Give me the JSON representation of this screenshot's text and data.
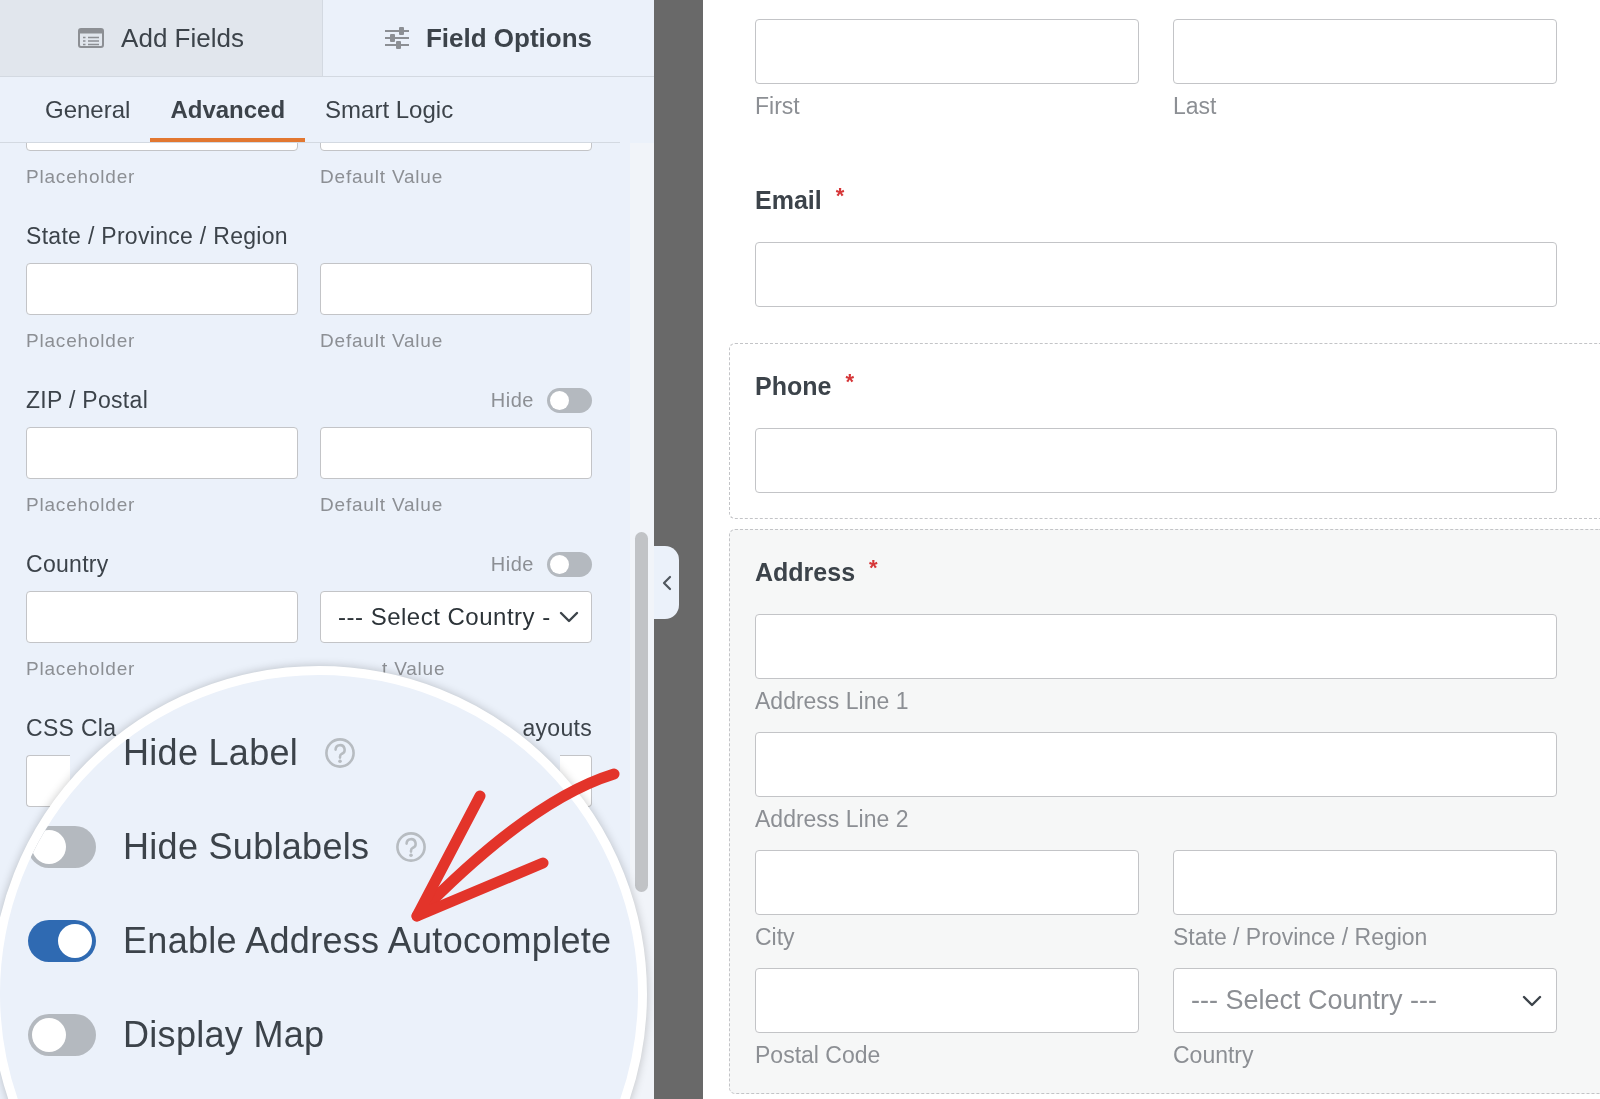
{
  "panel_tabs": [
    {
      "label": "Add Fields",
      "selected": false
    },
    {
      "label": "Field Options",
      "selected": true
    }
  ],
  "option_tabs": [
    {
      "label": "General",
      "selected": false
    },
    {
      "label": "Advanced",
      "selected": true
    },
    {
      "label": "Smart Logic",
      "selected": false
    }
  ],
  "option_sections": [
    {
      "fields": [
        {
          "kind": "input",
          "sublabel": "Placeholder"
        },
        {
          "kind": "input",
          "sublabel": "Default Value"
        }
      ]
    },
    {
      "label": "State / Province / Region",
      "fields": [
        {
          "kind": "input",
          "sublabel": "Placeholder"
        },
        {
          "kind": "input",
          "sublabel": "Default Value"
        }
      ]
    },
    {
      "label": "ZIP / Postal",
      "hide_toggle": {
        "label": "Hide",
        "on": false
      },
      "fields": [
        {
          "kind": "input",
          "sublabel": "Placeholder"
        },
        {
          "kind": "input",
          "sublabel": "Default Value"
        }
      ]
    },
    {
      "label": "Country",
      "hide_toggle": {
        "label": "Hide",
        "on": false
      },
      "fields": [
        {
          "kind": "input",
          "sublabel": "Placeholder"
        },
        {
          "kind": "select",
          "value": "--- Select Country -",
          "sublabel": "t Value"
        }
      ]
    },
    {
      "label": "CSS Cla",
      "aside": "ayouts",
      "fields": [
        {
          "kind": "input"
        },
        {
          "kind": "input"
        }
      ]
    }
  ],
  "magnifier": {
    "options": [
      {
        "label": "Hide Label",
        "help": true
      },
      {
        "label": "Hide Sublabels",
        "on": false,
        "help": true
      },
      {
        "label": "Enable Address Autocomplete",
        "on": true,
        "help": false
      },
      {
        "label": "Display Map",
        "on": false,
        "help": false
      }
    ]
  },
  "form_preview": {
    "fields": [
      {
        "selected": false,
        "hovered": false,
        "rows": [
          [
            {
              "kind": "input",
              "sublabel": "First"
            },
            {
              "kind": "input",
              "sublabel": "Last"
            }
          ]
        ]
      },
      {
        "label": "Email",
        "required_mark": "*",
        "selected": false,
        "hovered": false,
        "rows": [
          [
            {
              "kind": "input"
            }
          ]
        ]
      },
      {
        "label": "Phone",
        "required_mark": "*",
        "selected": false,
        "hovered": true,
        "rows": [
          [
            {
              "kind": "input"
            }
          ]
        ]
      },
      {
        "label": "Address",
        "required_mark": "*",
        "selected": true,
        "hovered": false,
        "rows": [
          [
            {
              "kind": "input",
              "sublabel": "Address Line 1"
            }
          ],
          [
            {
              "kind": "input",
              "sublabel": "Address Line 2"
            }
          ],
          [
            {
              "kind": "input",
              "sublabel": "City"
            },
            {
              "kind": "input",
              "sublabel": "State / Province / Region"
            }
          ],
          [
            {
              "kind": "input",
              "sublabel": "Postal Code"
            },
            {
              "kind": "select",
              "value": "--- Select Country ---",
              "sublabel": "Country"
            }
          ]
        ]
      }
    ]
  }
}
